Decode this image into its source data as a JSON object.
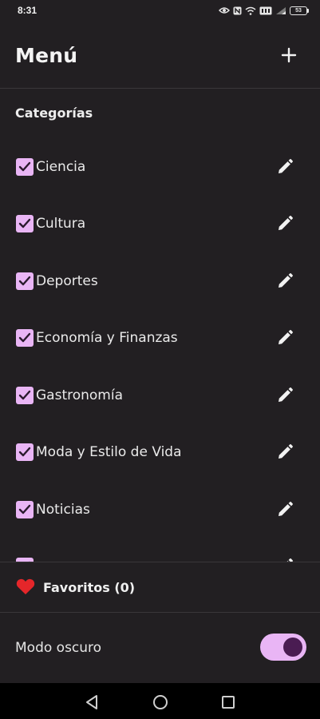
{
  "status_bar": {
    "time": "8:31",
    "battery": "53",
    "icons": [
      "eye-icon",
      "nfc-icon",
      "wifi-icon",
      "wifi-6-badge-icon",
      "signal-icon",
      "battery-icon"
    ]
  },
  "header": {
    "title": "Menú",
    "add_icon": "plus-icon"
  },
  "categories": {
    "title": "Categorías",
    "items": [
      {
        "label": "Ciencia",
        "checked": true
      },
      {
        "label": "Cultura",
        "checked": true
      },
      {
        "label": "Deportes",
        "checked": true
      },
      {
        "label": "Economía y Finanzas",
        "checked": true
      },
      {
        "label": "Gastronomía",
        "checked": true
      },
      {
        "label": "Moda y Estilo de Vida",
        "checked": true
      },
      {
        "label": "Noticias",
        "checked": true
      }
    ],
    "edit_icon": "pencil-icon"
  },
  "favorites": {
    "label": "Favoritos (0)",
    "icon": "heart-icon"
  },
  "settings": {
    "dark_mode_label": "Modo oscuro",
    "dark_mode_enabled": true
  },
  "nav_bar": {
    "buttons": [
      "back-triangle-icon",
      "home-circle-icon",
      "recents-square-icon"
    ]
  },
  "colors": {
    "background": "#221F22",
    "accent": "#E9B5F5",
    "toggle_thumb": "#4A1C52",
    "heart": "#E5262A",
    "divider": "#3A373A"
  }
}
